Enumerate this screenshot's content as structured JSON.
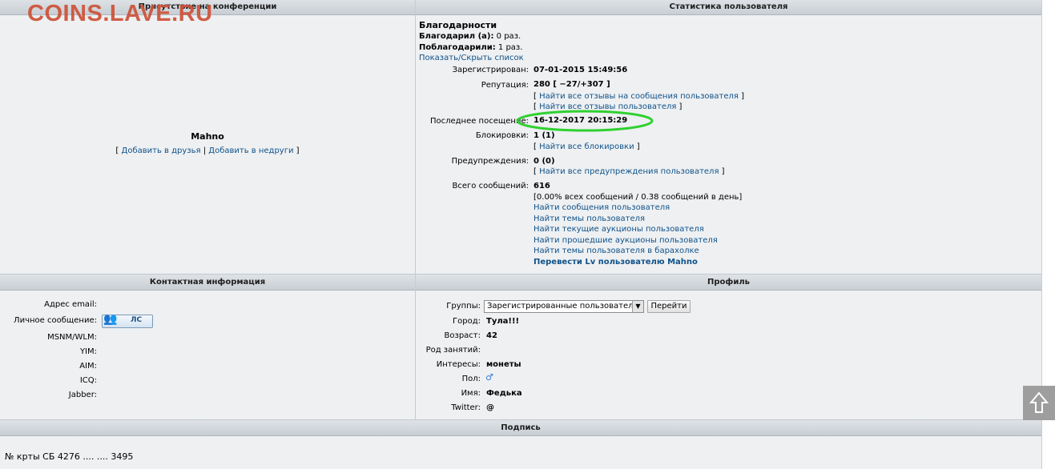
{
  "watermark": "COINS.LAVE.RU",
  "sections": {
    "conference": "Присутствие на конференции",
    "stats": "Статистика пользователя",
    "contact": "Контактная информация",
    "profile": "Профиль",
    "signature": "Подпись"
  },
  "user": {
    "name": "Mahno",
    "friend_open": "[",
    "add_friend": "Добавить в друзья",
    "sep": "|",
    "add_foe": "Добавить в недруги",
    "friend_close": "]"
  },
  "thanks": {
    "title": "Благодарности",
    "gave_label": "Благодарил (а):",
    "gave_value": "0 раз.",
    "received_label": "Поблагодарили:",
    "received_value": "1 раз.",
    "toggle": "Показать/Скрыть список"
  },
  "stats": {
    "registered_label": "Зарегистрирован:",
    "registered_value": "07-01-2015 15:49:56",
    "reputation_label": "Репутация:",
    "reputation_value": "280 [ −27/+307 ]",
    "rep_link1": "Найти все отзывы на сообщения пользователя",
    "rep_link2": "Найти все отзывы пользователя",
    "last_visit_label": "Последнее посещение:",
    "last_visit_value": "16-12-2017 20:15:29",
    "bans_label": "Блокировки:",
    "bans_value": "1 (1)",
    "bans_link": "Найти все блокировки",
    "warnings_label": "Предупреждения:",
    "warnings_value": "0 (0)",
    "warnings_link": "Найти все предупреждения пользователя",
    "posts_label": "Всего сообщений:",
    "posts_value": "616",
    "posts_detail": "[0.00% всех сообщений / 0.38 сообщений в день]",
    "link_posts": "Найти сообщения пользователя",
    "link_topics": "Найти темы пользователя",
    "link_auctions_current": "Найти текущие аукционы пользователя",
    "link_auctions_past": "Найти прошедшие аукционы пользователя",
    "link_flea": "Найти темы пользователя в барахолке",
    "link_transfer": "Перевести Lv пользователю Mahno"
  },
  "contact": {
    "email_label": "Адрес email:",
    "pm_label": "Личное сообщение:",
    "pm_button": "ЛС",
    "msn_label": "MSNM/WLM:",
    "yim_label": "YIM:",
    "aim_label": "AIM:",
    "icq_label": "ICQ:",
    "jabber_label": "Jabber:"
  },
  "profile": {
    "groups_label": "Группы:",
    "groups_value": "Зарегистрированные пользователи",
    "go_button": "Перейти",
    "city_label": "Город:",
    "city_value": "Тула!!!",
    "age_label": "Возраст:",
    "age_value": "42",
    "occupation_label": "Род занятий:",
    "interests_label": "Интересы:",
    "interests_value": "монеты",
    "gender_label": "Пол:",
    "gender_icon": "male-icon",
    "name_label": "Имя:",
    "name_value": "Федька",
    "twitter_label": "Twitter:",
    "twitter_value": "@"
  },
  "signature": {
    "text": "№ крты СБ 4276 .... .... 3495"
  },
  "colors": {
    "link": "#105289",
    "highlight_ring": "#2fd12f",
    "panel": "#eef0f2"
  }
}
